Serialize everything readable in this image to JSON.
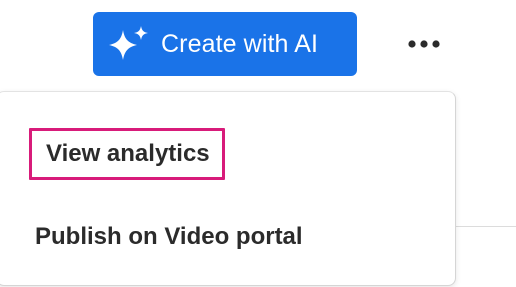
{
  "toolbar": {
    "create_ai_label": "Create with AI",
    "create_ai_icon": "sparkle-icon",
    "more_icon": "ellipsis-icon",
    "accent_color": "#1a73e8"
  },
  "menu": {
    "items": [
      {
        "label": "View analytics",
        "highlighted": true
      },
      {
        "label": "Publish on Video portal",
        "highlighted": false
      }
    ],
    "highlight_color": "#d81b7a"
  }
}
